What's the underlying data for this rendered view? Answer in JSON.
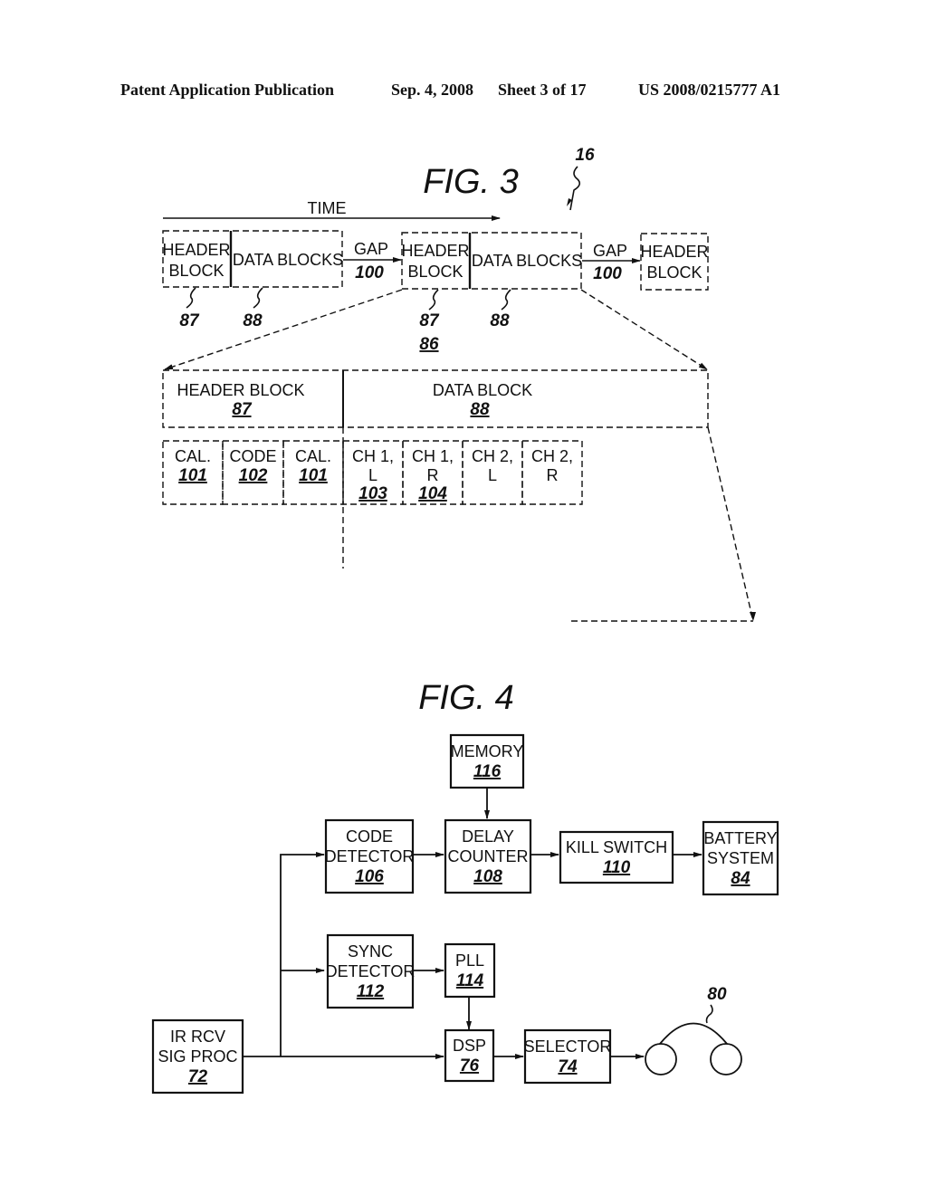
{
  "header": {
    "publication": "Patent Application Publication",
    "date": "Sep. 4, 2008",
    "sheet": "Sheet 3 of 17",
    "number": "US 2008/0215777 A1"
  },
  "fig3": {
    "title": "FIG. 3",
    "ref_main": "16",
    "time_label": "TIME",
    "stream": {
      "header_block_l1": "HEADER",
      "header_block_l2": "BLOCK",
      "data_blocks": "DATA BLOCKS",
      "gap": "GAP",
      "gap_ref": "100",
      "header_ref": "87",
      "data_ref": "88",
      "frame_ref": "86"
    },
    "expanded": {
      "header_title": "HEADER BLOCK",
      "header_ref": "87",
      "data_title": "DATA BLOCK",
      "data_ref": "88"
    },
    "cells": [
      {
        "l1": "CAL.",
        "l2": "",
        "ref": "101"
      },
      {
        "l1": "CODE",
        "l2": "",
        "ref": "102"
      },
      {
        "l1": "CAL.",
        "l2": "",
        "ref": "101"
      },
      {
        "l1": "CH 1,",
        "l2": "L",
        "ref": "103"
      },
      {
        "l1": "CH 1,",
        "l2": "R",
        "ref": "104"
      },
      {
        "l1": "CH 2,",
        "l2": "L",
        "ref": ""
      },
      {
        "l1": "CH 2,",
        "l2": "R",
        "ref": ""
      }
    ]
  },
  "fig4": {
    "title": "FIG. 4",
    "blocks": {
      "memory": {
        "l1": "MEMORY",
        "l2": "",
        "ref": "116"
      },
      "code_detector": {
        "l1": "CODE",
        "l2": "DETECTOR",
        "ref": "106"
      },
      "delay_counter": {
        "l1": "DELAY",
        "l2": "COUNTER",
        "ref": "108"
      },
      "kill_switch": {
        "l1": "KILL SWITCH",
        "l2": "",
        "ref": "110"
      },
      "battery_system": {
        "l1": "BATTERY",
        "l2": "SYSTEM",
        "ref": "84"
      },
      "sync_detector": {
        "l1": "SYNC",
        "l2": "DETECTOR",
        "ref": "112"
      },
      "pll": {
        "l1": "PLL",
        "l2": "",
        "ref": "114"
      },
      "ir_rcv": {
        "l1": "IR RCV",
        "l2": "SIG PROC",
        "ref": "72"
      },
      "dsp": {
        "l1": "DSP",
        "l2": "",
        "ref": "76"
      },
      "selector": {
        "l1": "SELECTOR",
        "l2": "",
        "ref": "74"
      }
    },
    "headphones_ref": "80"
  }
}
